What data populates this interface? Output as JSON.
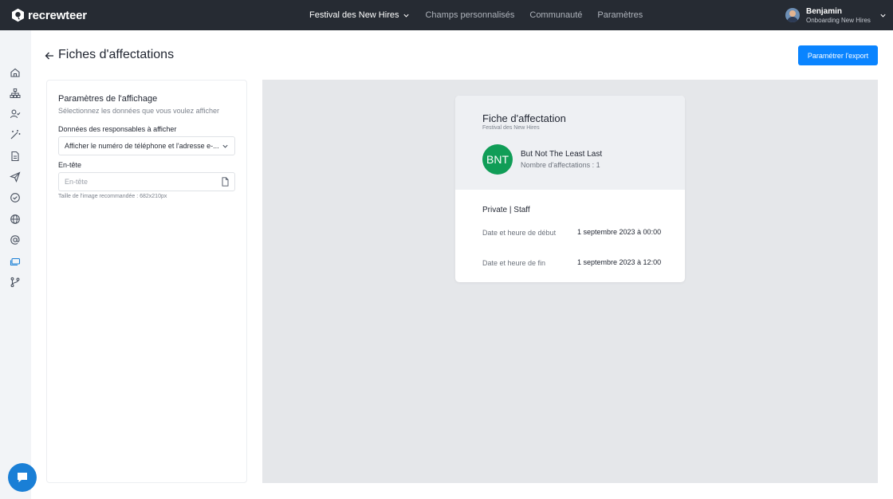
{
  "app": {
    "brand": "recrewteer"
  },
  "nav": {
    "items": [
      {
        "label": "Festival des New Hires",
        "active": true,
        "has_dropdown": true
      },
      {
        "label": "Champs personnalisés",
        "active": false
      },
      {
        "label": "Communauté",
        "active": false
      },
      {
        "label": "Paramètres",
        "active": false
      }
    ]
  },
  "user": {
    "name": "Benjamin",
    "subtitle": "Onboarding New Hires"
  },
  "sidebar": {
    "items": [
      {
        "icon": "home-icon",
        "active": false
      },
      {
        "icon": "org-chart-icon",
        "active": false
      },
      {
        "icon": "user-check-icon",
        "active": false
      },
      {
        "icon": "magic-wand-icon",
        "active": false
      },
      {
        "icon": "document-icon",
        "active": false
      },
      {
        "icon": "send-icon",
        "active": false
      },
      {
        "icon": "check-circle-icon",
        "active": false
      },
      {
        "icon": "globe-icon",
        "active": false
      },
      {
        "icon": "at-sign-icon",
        "active": false
      },
      {
        "icon": "tickets-icon",
        "active": true
      },
      {
        "icon": "git-branch-icon",
        "active": false
      }
    ]
  },
  "page": {
    "title": "Fiches d'affectations",
    "export_label": "Paramétrer l'export"
  },
  "settings": {
    "title": "Paramètres de l'affichage",
    "subtitle": "Sélectionnez les données que vous voulez afficher",
    "manager_label": "Données des responsables à afficher",
    "manager_value": "Afficher le numéro de téléphone et l'adresse e-...",
    "header_label": "En-tête",
    "header_placeholder": "En-tête",
    "header_hint": "Taille de l'image recommandée : 682x210px"
  },
  "card": {
    "title": "Fiche d'affectation",
    "event": "Festival des New Hires",
    "initials": "BNT",
    "person_name": "But Not The Least Last",
    "assignment_count": "Nombre d'affectations : 1",
    "section": "Private | Staff",
    "start_label": "Date et heure de début",
    "start_value": "1 septembre 2023 à 00:00",
    "end_label": "Date et heure de fin",
    "end_value": "1 septembre 2023 à 12:00"
  },
  "colors": {
    "topbar": "#262b33",
    "accent": "#0a84ff",
    "badge": "#109d57",
    "preview_bg": "#e5e7ea"
  }
}
